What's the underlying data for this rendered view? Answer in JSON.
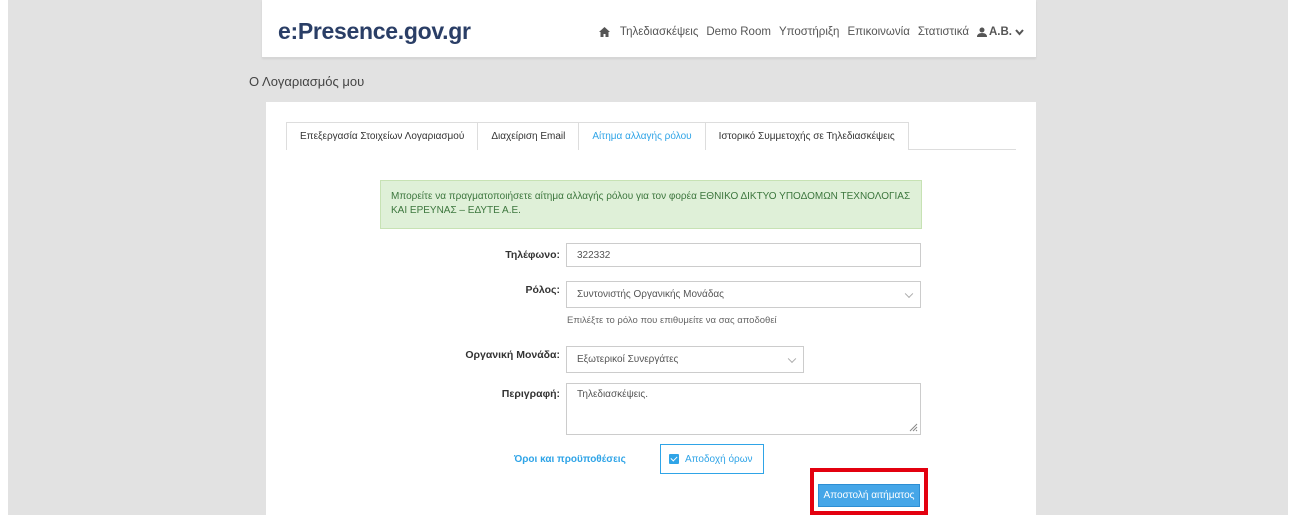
{
  "navbar": {
    "logo_prefix": "e",
    "logo_rest": ":Presence.gov.gr",
    "links": [
      "Τηλεδιασκέψεις",
      "Demo Room",
      "Υποστήριξη",
      "Επικοινωνία",
      "Στατιστικά"
    ],
    "user": "Α.Β."
  },
  "page_title": "Ο Λογαριασμός μου",
  "tabs": [
    "Επεξεργασία Στοιχείων Λογαριασμού",
    "Διαχείριση Email",
    "Αίτημα αλλαγής ρόλου",
    "Ιστορικό Συμμετοχής σε Τηλεδιασκέψεις"
  ],
  "alert": "Μπορείτε να πραγματοποιήσετε αίτημα αλλαγής ρόλου για τον φορέα ΕΘΝΙΚΟ ΔΙΚΤΥΟ ΥΠΟΔΟΜΩΝ ΤΕΧΝΟΛΟΓΙΑΣ ΚΑΙ ΕΡΕΥΝΑΣ – ΕΔΥΤΕ Α.Ε.",
  "form": {
    "phone_label": "Τηλέφωνο:",
    "phone_value": "322332",
    "role_label": "Ρόλος:",
    "role_value": "Συντονιστής Οργανικής Μονάδας",
    "role_help": "Επιλέξτε το ρόλο που επιθυμείτε να σας αποδοθεί",
    "unit_label": "Οργανική Μονάδα:",
    "unit_value": "Εξωτερικοί Συνεργάτες",
    "desc_label": "Περιγραφή:",
    "desc_value": "Τηλεδιασκέψεις.",
    "terms_link": "Όροι και προϋποθέσεις",
    "accept_label": "Αποδοχή όρων",
    "accept_checked": true,
    "submit_label": "Αποστολή αιτήματος"
  },
  "colors": {
    "brand": "#2a3e66",
    "accent": "#2fa4e7",
    "highlight": "#e3000f",
    "alert_bg": "#dff0d8"
  }
}
